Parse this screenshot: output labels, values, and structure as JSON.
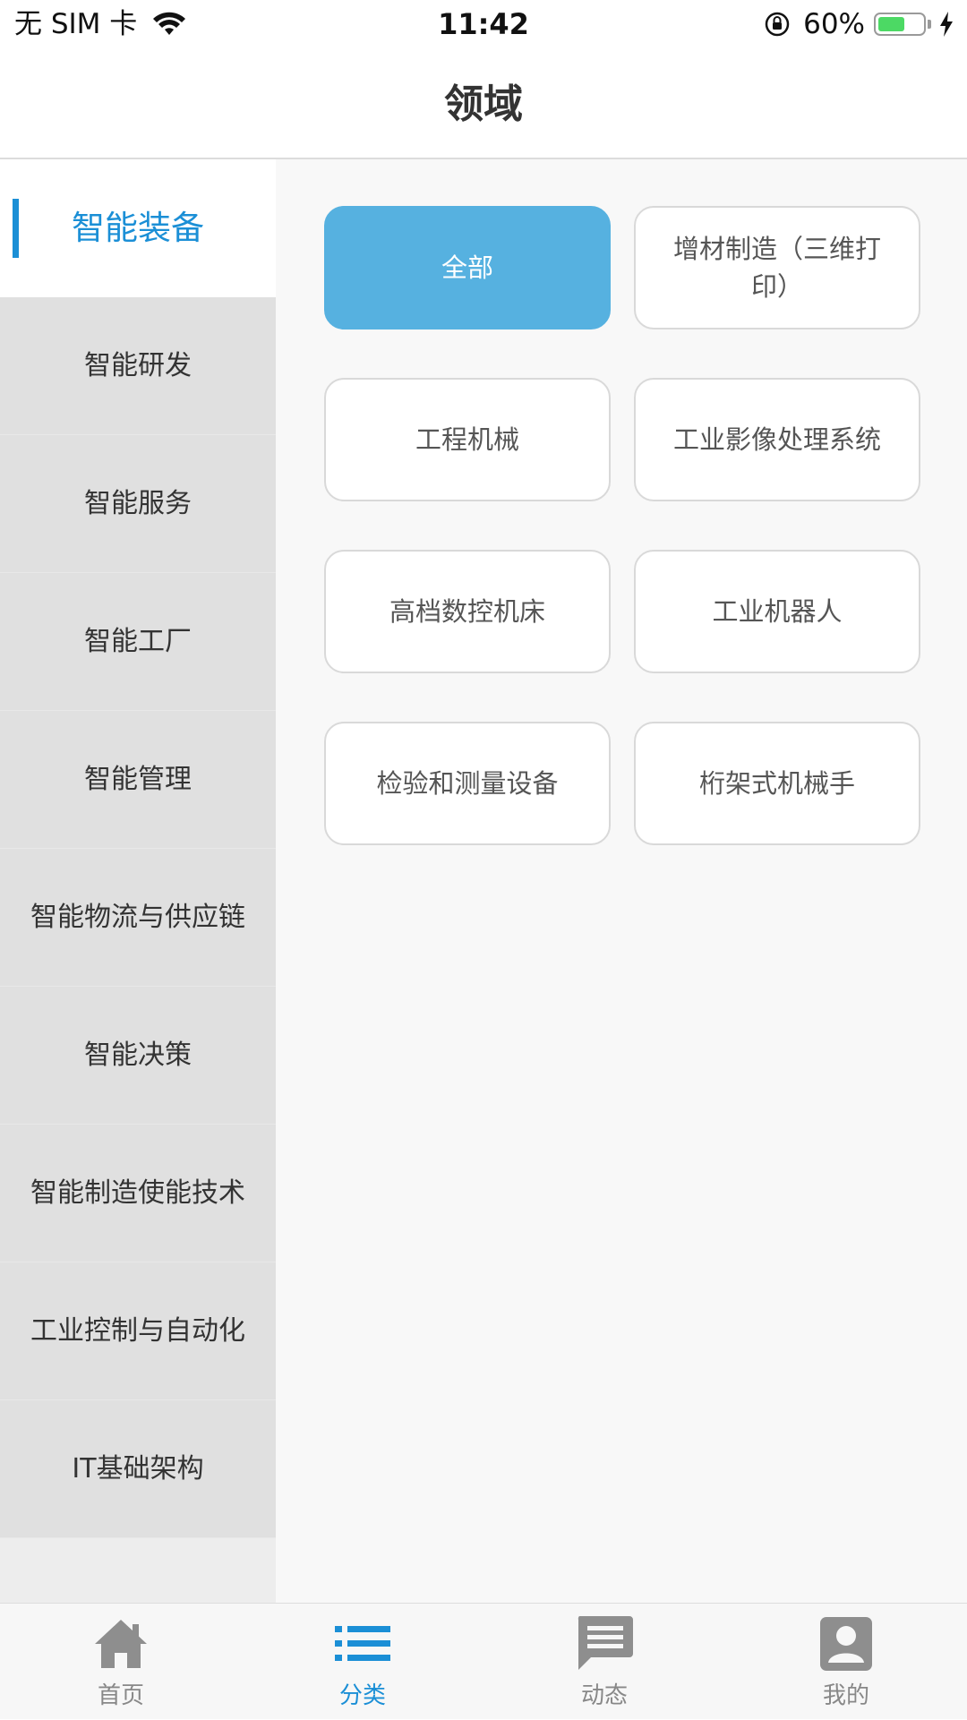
{
  "status_bar": {
    "carrier": "无 SIM 卡",
    "time": "11:42",
    "battery": "60%",
    "battery_level": 0.6
  },
  "nav": {
    "title": "领域"
  },
  "sidebar": {
    "items": [
      {
        "label": "智能装备",
        "selected": true
      },
      {
        "label": "智能研发"
      },
      {
        "label": "智能服务"
      },
      {
        "label": "智能工厂"
      },
      {
        "label": "智能管理"
      },
      {
        "label": "智能物流与供应链"
      },
      {
        "label": "智能决策"
      },
      {
        "label": "智能制造使能技术"
      },
      {
        "label": "工业控制与自动化"
      },
      {
        "label": "IT基础架构"
      }
    ]
  },
  "content": {
    "tags": [
      {
        "label": "全部",
        "selected": true
      },
      {
        "label": "增材制造（三维打印）"
      },
      {
        "label": "工程机械"
      },
      {
        "label": "工业影像处理系统"
      },
      {
        "label": "高档数控机床"
      },
      {
        "label": "工业机器人"
      },
      {
        "label": "检验和测量设备"
      },
      {
        "label": "桁架式机械手"
      }
    ]
  },
  "tab_bar": {
    "tabs": [
      {
        "label": "首页",
        "icon": "home-icon"
      },
      {
        "label": "分类",
        "icon": "list-icon",
        "selected": true
      },
      {
        "label": "动态",
        "icon": "message-icon"
      },
      {
        "label": "我的",
        "icon": "profile-icon"
      }
    ]
  },
  "colors": {
    "accent": "#1b8fd6",
    "selected_tag": "#56b1e0",
    "sidebar_bg": "#e0e0e0",
    "battery_green": "#4cd964"
  }
}
